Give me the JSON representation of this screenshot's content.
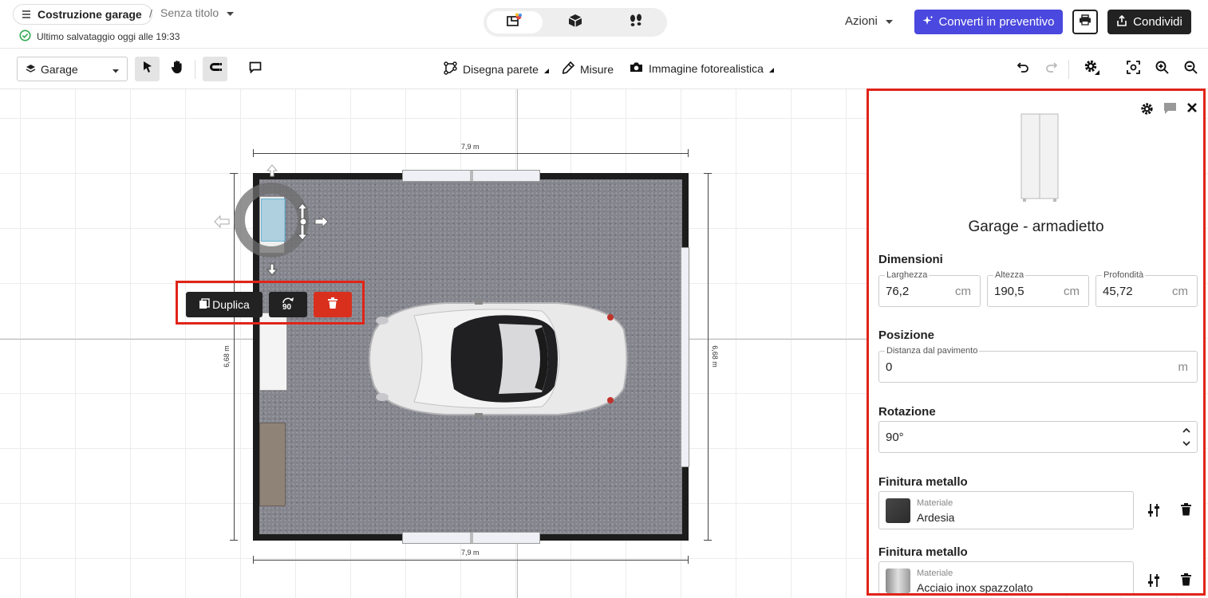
{
  "header": {
    "project_name": "Costruzione garage",
    "separator": "/",
    "design_name": "Senza titolo",
    "save_status": "Ultimo salvataggio oggi alle 19:33",
    "view_modes": [
      "2d-plan-icon",
      "3d-box-icon",
      "walkthrough-footsteps-icon"
    ],
    "actions_label": "Azioni",
    "convert_label": "Converti in preventivo",
    "share_label": "Condividi",
    "accent_color": "#4a48de"
  },
  "toolbar": {
    "floor_selector": "Garage",
    "draw_wall_label": "Disegna parete",
    "measures_label": "Misure",
    "photo_label": "Immagine fotorealistica"
  },
  "canvas": {
    "dim_top": "7,9 m",
    "dim_bottom": "7,9 m",
    "dim_left": "6,68 m",
    "dim_right": "6,68 m",
    "duplicate_label": "Duplica",
    "rotate_label": "90"
  },
  "panel": {
    "title": "Garage - armadietto",
    "dimensions": {
      "heading": "Dimensioni",
      "width": {
        "label": "Larghezza",
        "value": "76,2",
        "unit": "cm"
      },
      "height": {
        "label": "Altezza",
        "value": "190,5",
        "unit": "cm"
      },
      "depth": {
        "label": "Profondità",
        "value": "45,72",
        "unit": "cm"
      }
    },
    "position": {
      "heading": "Posizione",
      "floor_distance": {
        "label": "Distanza dal pavimento",
        "value": "0",
        "unit": "m"
      }
    },
    "rotation": {
      "heading": "Rotazione",
      "value": "90°"
    },
    "finishes": [
      {
        "heading": "Finitura metallo",
        "label": "Materiale",
        "value": "Ardesia",
        "swatch": "#3a3a3a"
      },
      {
        "heading": "Finitura metallo",
        "label": "Materiale",
        "value": "Acciaio inox spazzolato",
        "swatch": "#b8b8b8"
      }
    ]
  }
}
